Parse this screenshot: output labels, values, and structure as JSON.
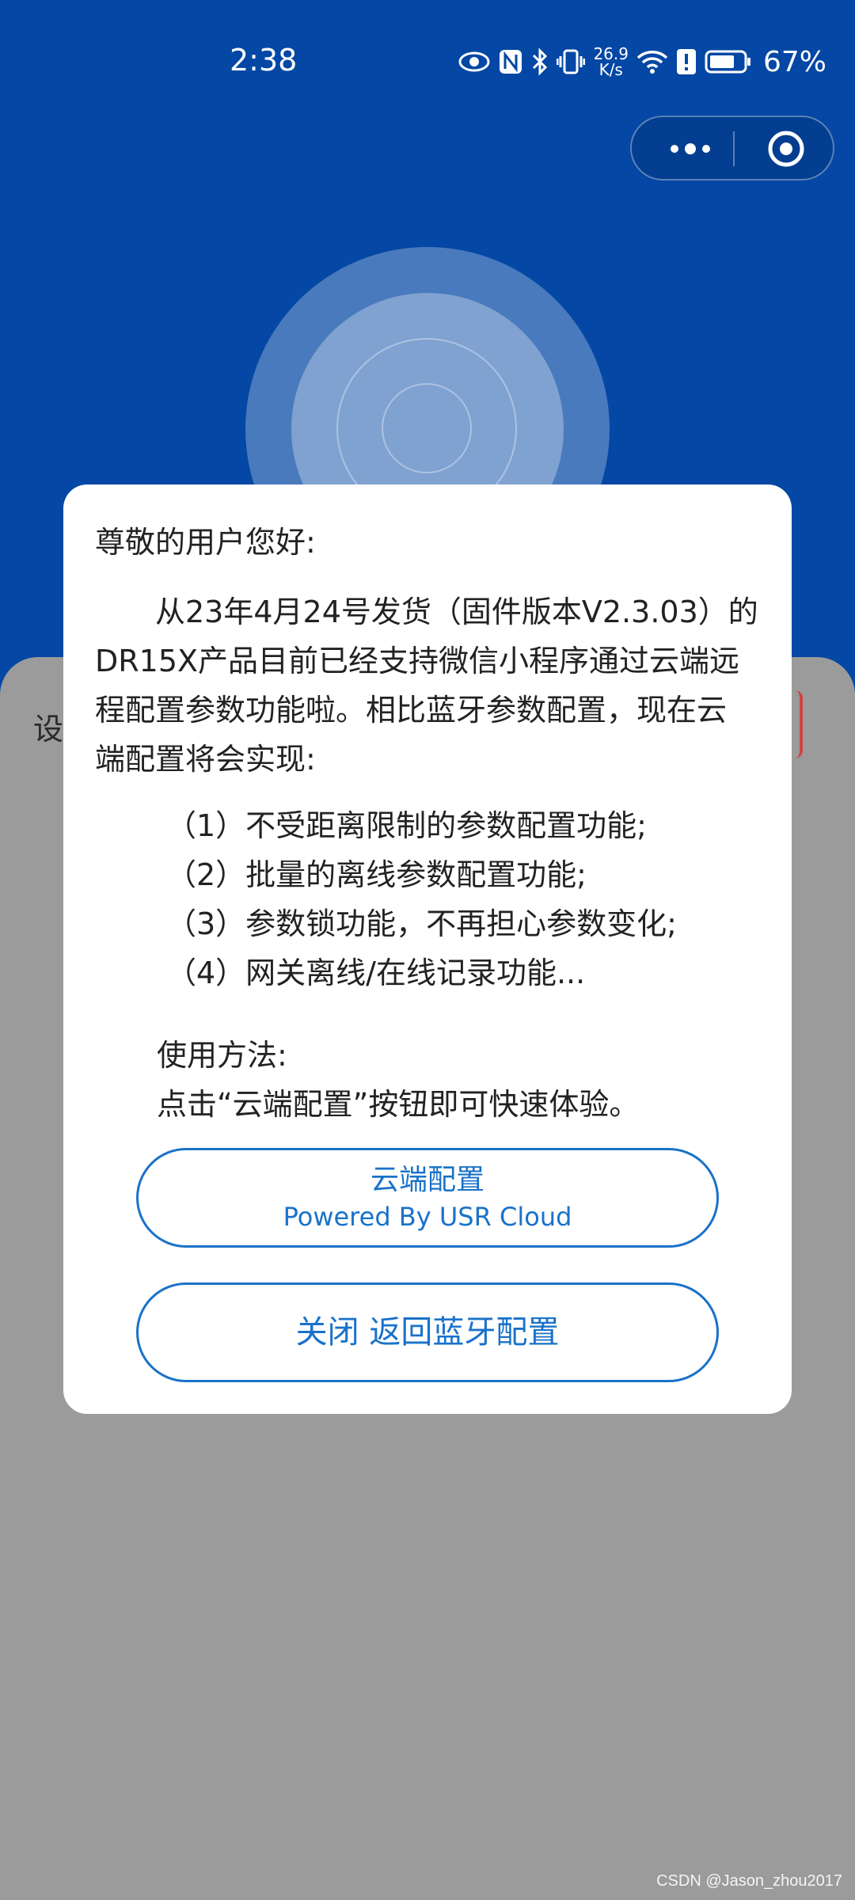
{
  "status_bar": {
    "time": "2:38",
    "net_speed_value": "26.9",
    "net_speed_unit": "K/s",
    "battery_percent": "67%",
    "icons": [
      "eye-icon",
      "nfc-icon",
      "bluetooth-icon",
      "vibrate-icon",
      "wifi-icon",
      "alert-icon",
      "battery-icon"
    ]
  },
  "capsule": {
    "more_icon": "more-dots-icon",
    "close_icon": "target-close-icon"
  },
  "background": {
    "left_text": "设",
    "accent_color": "#0447a4"
  },
  "dialog": {
    "greeting": "尊敬的用户您好:",
    "paragraph_lines": [
      "　　从23年4月24号发货（固件版本V2.3.03）的",
      "DR15X产品目前已经支持微信小程序通过云端远",
      "程配置参数功能啦。相比蓝牙参数配置，现在云",
      "端配置将会实现:"
    ],
    "features": [
      "（1）不受距离限制的参数配置功能;",
      "（2）批量的离线参数配置功能;",
      "（3）参数锁功能，不再担心参数变化;",
      "（4）网关离线/在线记录功能..."
    ],
    "usage_title": "使用方法:",
    "usage_text": "点击“云端配置”按钮即可快速体验。",
    "cloud_button": {
      "label": "云端配置",
      "sublabel": "Powered By USR Cloud"
    },
    "close_button": {
      "label": "关闭 返回蓝牙配置"
    },
    "button_color": "#1a72c9"
  },
  "watermark": "CSDN @Jason_zhou2017"
}
